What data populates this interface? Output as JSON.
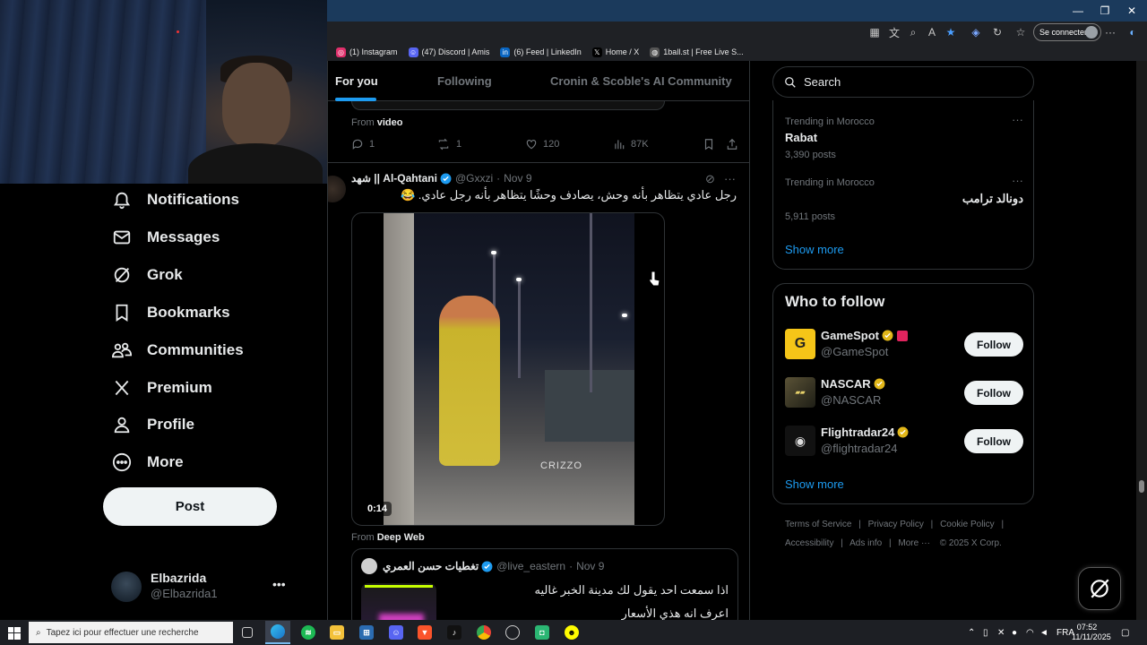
{
  "browser": {
    "signin_label": "Se connecter",
    "bookmarks": [
      {
        "label": "(1) Instagram",
        "icon": "instagram-icon",
        "color": "#e1306c"
      },
      {
        "label": "(47) Discord | Amis",
        "icon": "discord-icon",
        "color": "#5865f2"
      },
      {
        "label": "(6) Feed | LinkedIn",
        "icon": "linkedin-icon",
        "color": "#0a66c2"
      },
      {
        "label": "Home / X",
        "icon": "x-icon",
        "color": "#000000"
      },
      {
        "label": "1ball.st | Free Live S...",
        "icon": "globe-icon",
        "color": "#555555"
      }
    ]
  },
  "nav": {
    "items": [
      {
        "label": "Notifications",
        "icon": "bell-icon"
      },
      {
        "label": "Messages",
        "icon": "envelope-icon"
      },
      {
        "label": "Grok",
        "icon": "grok-icon"
      },
      {
        "label": "Bookmarks",
        "icon": "bookmark-icon"
      },
      {
        "label": "Communities",
        "icon": "communities-icon"
      },
      {
        "label": "Premium",
        "icon": "x-logo-icon"
      },
      {
        "label": "Profile",
        "icon": "person-icon"
      },
      {
        "label": "More",
        "icon": "more-circle-icon"
      }
    ],
    "post_label": "Post",
    "account": {
      "name": "Elbazrida",
      "handle": "@Elbazrida1"
    }
  },
  "feed": {
    "tabs": [
      "For you",
      "Following",
      "Cronin & Scoble's AI Community"
    ],
    "active_tab": "For you",
    "prev_tweet": {
      "from_label": "From",
      "from_source": "video",
      "replies": "1",
      "reposts": "1",
      "likes": "120",
      "views": "87K"
    },
    "tweet": {
      "name": "شهد || Al-Qahtani",
      "handle": "@Gxxzi",
      "date": "Nov 9",
      "text": "رجل عادي يتظاهر بأنه وحش، يصادف وحشًا يتظاهر بأنه رجل عادي. 😂",
      "video_duration": "0:14",
      "video_watermark": "CRIZZO",
      "from_label": "From",
      "from_source": "Deep Web"
    },
    "quote": {
      "name": "تغطيات حسن العمري",
      "handle": "@live_eastern",
      "date": "Nov 9",
      "text": "اذا سمعت احد يقول لك مدينة الخبر غاليه",
      "text2": "اعرف انه هذي الأسعار"
    }
  },
  "sidebar": {
    "search_placeholder": "Search",
    "trends": [
      {
        "context": "Trending in Morocco",
        "topic": "Rabat",
        "count": "3,390 posts"
      },
      {
        "context": "Trending in Morocco",
        "topic": "دونالد ترامب",
        "count": "5,911 posts"
      }
    ],
    "show_more": "Show more",
    "who_to_follow_title": "Who to follow",
    "follow_label": "Follow",
    "suggestions": [
      {
        "name": "GameSpot",
        "handle": "@GameSpot",
        "color": "#f5c518"
      },
      {
        "name": "NASCAR",
        "handle": "@NASCAR",
        "color": "#3a3a2a"
      },
      {
        "name": "Flightradar24",
        "handle": "@flightradar24",
        "color": "#111111"
      }
    ],
    "footer": [
      "Terms of Service",
      "Privacy Policy",
      "Cookie Policy",
      "Accessibility",
      "Ads info",
      "More ···",
      "© 2025 X Corp."
    ]
  },
  "taskbar": {
    "search_placeholder": "Tapez ici pour effectuer une recherche",
    "lang": "FRA",
    "time": "07:52",
    "date": "11/11/2025"
  },
  "colors": {
    "accent": "#1d9bf0",
    "verified": "#1d9bf0",
    "gold": "#e2b719"
  }
}
